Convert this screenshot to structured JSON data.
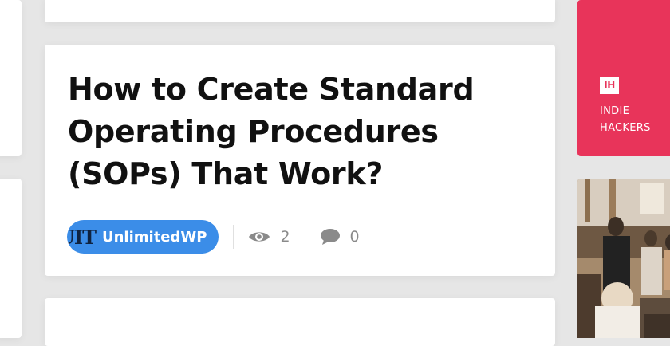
{
  "post": {
    "title": "How to Create Standard Operating Procedures (SOPs) That Work?",
    "author": {
      "name": "UnlimitedWP",
      "avatar_text": "UIT"
    },
    "views": "2",
    "comments": "0"
  },
  "sidebar": {
    "indie_hackers": {
      "logo_text": "IH",
      "label_line1": "INDIE",
      "label_line2": "HACKERS"
    }
  },
  "colors": {
    "indie_hackers": "#e8345a",
    "author_badge": "#3b8de8",
    "meta_gray": "#8a8a8a"
  },
  "icons": [
    "eye-icon",
    "comment-icon"
  ]
}
